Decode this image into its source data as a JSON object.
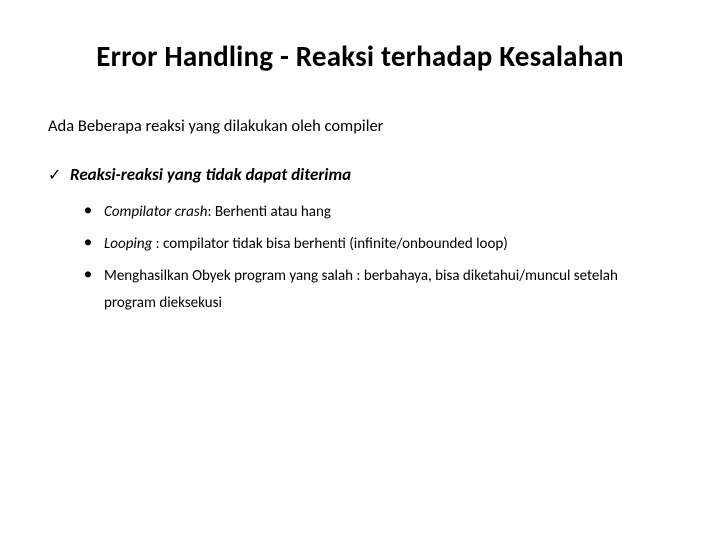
{
  "title": "Error Handling - Reaksi terhadap Kesalahan",
  "intro": "Ada Beberapa reaksi yang dilakukan oleh compiler",
  "section": {
    "heading": "Reaksi-reaksi yang tidak dapat diterima",
    "items": [
      {
        "lead": "Compilator crash",
        "rest": ": Berhenti atau hang"
      },
      {
        "lead": "Looping",
        "rest": " : compilator tidak bisa berhenti (infinite/onbounded loop)"
      },
      {
        "lead": "",
        "rest": "Menghasilkan Obyek program yang salah : berbahaya, bisa diketahui/muncul setelah program dieksekusi"
      }
    ]
  },
  "icons": {
    "check": "✓",
    "dot": "●"
  }
}
